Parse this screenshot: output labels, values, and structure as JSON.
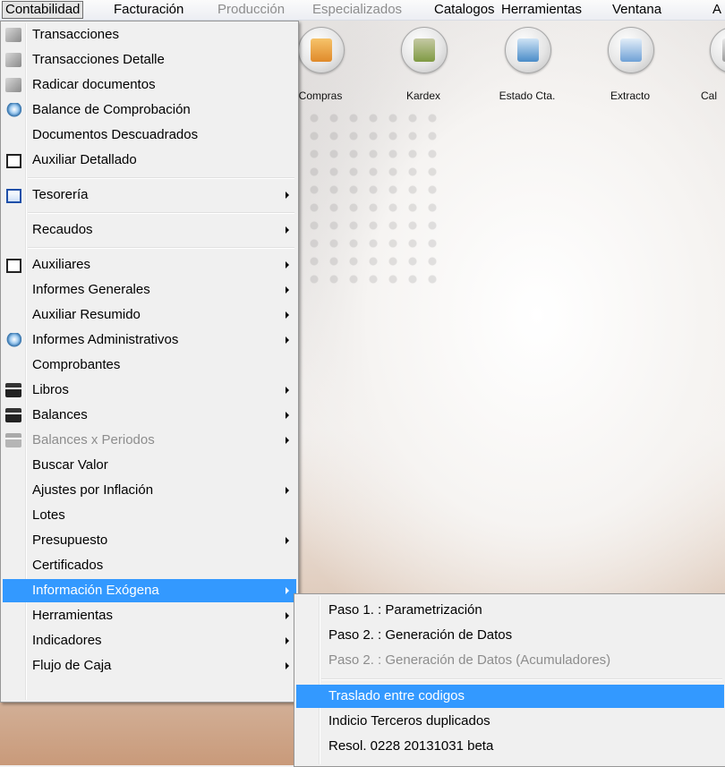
{
  "menubar": {
    "items": [
      {
        "label": "Contabilidad",
        "state": "open"
      },
      {
        "label": "Facturación",
        "state": "normal"
      },
      {
        "label": "Producción",
        "state": "disabled"
      },
      {
        "label": "Especializados",
        "state": "disabled"
      },
      {
        "label": "Catalogos",
        "state": "normal"
      },
      {
        "label": "Herramientas",
        "state": "normal"
      },
      {
        "label": "Ventana",
        "state": "normal"
      },
      {
        "label": "A",
        "state": "normal"
      }
    ]
  },
  "toolbar": {
    "buttons": [
      {
        "label": "Compras",
        "icon": "truck-icon",
        "color": "#f0a23a"
      },
      {
        "label": "Kardex",
        "icon": "clipboard-add-icon",
        "color": "#8ca04a"
      },
      {
        "label": "Estado Cta.",
        "icon": "id-card-icon",
        "color": "#4a8cc8"
      },
      {
        "label": "Extracto",
        "icon": "document-icon",
        "color": "#6fa1d6"
      },
      {
        "label": "Cal",
        "icon": "calculator-icon",
        "color": "#9a9a9a"
      }
    ]
  },
  "main_menu": {
    "items": [
      {
        "label": "Transacciones",
        "icon": "transactions-icon",
        "submenu": false
      },
      {
        "label": "Transacciones Detalle",
        "icon": "transactions-icon",
        "submenu": false
      },
      {
        "label": "Radicar documentos",
        "icon": "transactions-icon",
        "submenu": false
      },
      {
        "label": "Balance de Comprobación",
        "icon": "magnifier-icon",
        "submenu": false
      },
      {
        "label": "Documentos Descuadrados",
        "icon": "",
        "submenu": false
      },
      {
        "label": "Auxiliar Detallado",
        "icon": "ledger-icon",
        "submenu": false
      },
      {
        "label": "Tesorería",
        "icon": "checklist-icon",
        "submenu": true
      },
      {
        "label": "Recaudos",
        "icon": "",
        "submenu": true
      },
      {
        "label": "Auxiliares",
        "icon": "ledger-icon",
        "submenu": true
      },
      {
        "label": "Informes Generales",
        "icon": "",
        "submenu": true
      },
      {
        "label": "Auxiliar Resumido",
        "icon": "",
        "submenu": true
      },
      {
        "label": "Informes Administrativos",
        "icon": "magnifier-icon",
        "submenu": true
      },
      {
        "label": "Comprobantes",
        "icon": "",
        "submenu": false
      },
      {
        "label": "Libros",
        "icon": "printer-icon",
        "submenu": true
      },
      {
        "label": "Balances",
        "icon": "printer-icon",
        "submenu": true
      },
      {
        "label": "Balances x Periodos",
        "icon": "printer-icon",
        "submenu": true,
        "disabled": true
      },
      {
        "label": "Buscar Valor",
        "icon": "",
        "submenu": false
      },
      {
        "label": "Ajustes por Inflación",
        "icon": "",
        "submenu": true
      },
      {
        "label": "Lotes",
        "icon": "",
        "submenu": false
      },
      {
        "label": "Presupuesto",
        "icon": "",
        "submenu": true
      },
      {
        "label": "Certificados",
        "icon": "",
        "submenu": false
      },
      {
        "label": "Información Exógena",
        "icon": "",
        "submenu": true,
        "highlighted": true
      },
      {
        "label": "Herramientas",
        "icon": "",
        "submenu": true
      },
      {
        "label": "Indicadores",
        "icon": "",
        "submenu": true
      },
      {
        "label": "Flujo de Caja",
        "icon": "",
        "submenu": true
      }
    ]
  },
  "sub_menu": {
    "items": [
      {
        "label": "Paso 1. : Parametrización"
      },
      {
        "label": "Paso 2. : Generación de Datos"
      },
      {
        "label": "Paso 2. : Generación de Datos (Acumuladores)",
        "disabled": true
      },
      {
        "label": "Traslado entre codigos",
        "highlighted": true
      },
      {
        "label": "Indicio Terceros duplicados"
      },
      {
        "label": "Resol. 0228 20131031 beta"
      }
    ]
  },
  "colors": {
    "highlight": "#3399ff",
    "menu_bg": "#f0f0f0",
    "disabled_text": "#8d8d8d"
  }
}
